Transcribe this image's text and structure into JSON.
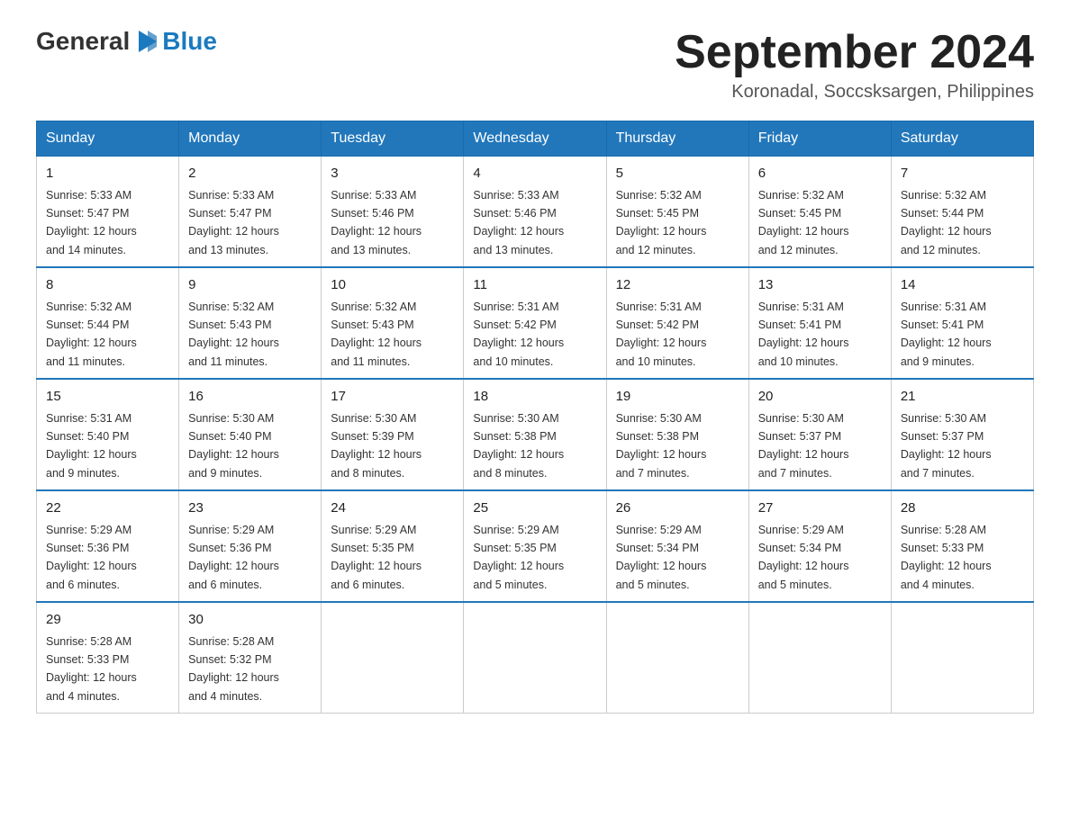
{
  "header": {
    "logo": {
      "text_general": "General",
      "text_blue": "Blue",
      "logo_symbol": "▶"
    },
    "title": "September 2024",
    "subtitle": "Koronadal, Soccsksargen, Philippines"
  },
  "days_of_week": [
    "Sunday",
    "Monday",
    "Tuesday",
    "Wednesday",
    "Thursday",
    "Friday",
    "Saturday"
  ],
  "weeks": [
    {
      "days": [
        {
          "num": "1",
          "sunrise": "5:33 AM",
          "sunset": "5:47 PM",
          "daylight": "12 hours and 14 minutes."
        },
        {
          "num": "2",
          "sunrise": "5:33 AM",
          "sunset": "5:47 PM",
          "daylight": "12 hours and 13 minutes."
        },
        {
          "num": "3",
          "sunrise": "5:33 AM",
          "sunset": "5:46 PM",
          "daylight": "12 hours and 13 minutes."
        },
        {
          "num": "4",
          "sunrise": "5:33 AM",
          "sunset": "5:46 PM",
          "daylight": "12 hours and 13 minutes."
        },
        {
          "num": "5",
          "sunrise": "5:32 AM",
          "sunset": "5:45 PM",
          "daylight": "12 hours and 12 minutes."
        },
        {
          "num": "6",
          "sunrise": "5:32 AM",
          "sunset": "5:45 PM",
          "daylight": "12 hours and 12 minutes."
        },
        {
          "num": "7",
          "sunrise": "5:32 AM",
          "sunset": "5:44 PM",
          "daylight": "12 hours and 12 minutes."
        }
      ]
    },
    {
      "days": [
        {
          "num": "8",
          "sunrise": "5:32 AM",
          "sunset": "5:44 PM",
          "daylight": "12 hours and 11 minutes."
        },
        {
          "num": "9",
          "sunrise": "5:32 AM",
          "sunset": "5:43 PM",
          "daylight": "12 hours and 11 minutes."
        },
        {
          "num": "10",
          "sunrise": "5:32 AM",
          "sunset": "5:43 PM",
          "daylight": "12 hours and 11 minutes."
        },
        {
          "num": "11",
          "sunrise": "5:31 AM",
          "sunset": "5:42 PM",
          "daylight": "12 hours and 10 minutes."
        },
        {
          "num": "12",
          "sunrise": "5:31 AM",
          "sunset": "5:42 PM",
          "daylight": "12 hours and 10 minutes."
        },
        {
          "num": "13",
          "sunrise": "5:31 AM",
          "sunset": "5:41 PM",
          "daylight": "12 hours and 10 minutes."
        },
        {
          "num": "14",
          "sunrise": "5:31 AM",
          "sunset": "5:41 PM",
          "daylight": "12 hours and 9 minutes."
        }
      ]
    },
    {
      "days": [
        {
          "num": "15",
          "sunrise": "5:31 AM",
          "sunset": "5:40 PM",
          "daylight": "12 hours and 9 minutes."
        },
        {
          "num": "16",
          "sunrise": "5:30 AM",
          "sunset": "5:40 PM",
          "daylight": "12 hours and 9 minutes."
        },
        {
          "num": "17",
          "sunrise": "5:30 AM",
          "sunset": "5:39 PM",
          "daylight": "12 hours and 8 minutes."
        },
        {
          "num": "18",
          "sunrise": "5:30 AM",
          "sunset": "5:38 PM",
          "daylight": "12 hours and 8 minutes."
        },
        {
          "num": "19",
          "sunrise": "5:30 AM",
          "sunset": "5:38 PM",
          "daylight": "12 hours and 7 minutes."
        },
        {
          "num": "20",
          "sunrise": "5:30 AM",
          "sunset": "5:37 PM",
          "daylight": "12 hours and 7 minutes."
        },
        {
          "num": "21",
          "sunrise": "5:30 AM",
          "sunset": "5:37 PM",
          "daylight": "12 hours and 7 minutes."
        }
      ]
    },
    {
      "days": [
        {
          "num": "22",
          "sunrise": "5:29 AM",
          "sunset": "5:36 PM",
          "daylight": "12 hours and 6 minutes."
        },
        {
          "num": "23",
          "sunrise": "5:29 AM",
          "sunset": "5:36 PM",
          "daylight": "12 hours and 6 minutes."
        },
        {
          "num": "24",
          "sunrise": "5:29 AM",
          "sunset": "5:35 PM",
          "daylight": "12 hours and 6 minutes."
        },
        {
          "num": "25",
          "sunrise": "5:29 AM",
          "sunset": "5:35 PM",
          "daylight": "12 hours and 5 minutes."
        },
        {
          "num": "26",
          "sunrise": "5:29 AM",
          "sunset": "5:34 PM",
          "daylight": "12 hours and 5 minutes."
        },
        {
          "num": "27",
          "sunrise": "5:29 AM",
          "sunset": "5:34 PM",
          "daylight": "12 hours and 5 minutes."
        },
        {
          "num": "28",
          "sunrise": "5:28 AM",
          "sunset": "5:33 PM",
          "daylight": "12 hours and 4 minutes."
        }
      ]
    },
    {
      "days": [
        {
          "num": "29",
          "sunrise": "5:28 AM",
          "sunset": "5:33 PM",
          "daylight": "12 hours and 4 minutes."
        },
        {
          "num": "30",
          "sunrise": "5:28 AM",
          "sunset": "5:32 PM",
          "daylight": "12 hours and 4 minutes."
        },
        null,
        null,
        null,
        null,
        null
      ]
    }
  ],
  "labels": {
    "sunrise": "Sunrise:",
    "sunset": "Sunset:",
    "daylight": "Daylight:"
  }
}
